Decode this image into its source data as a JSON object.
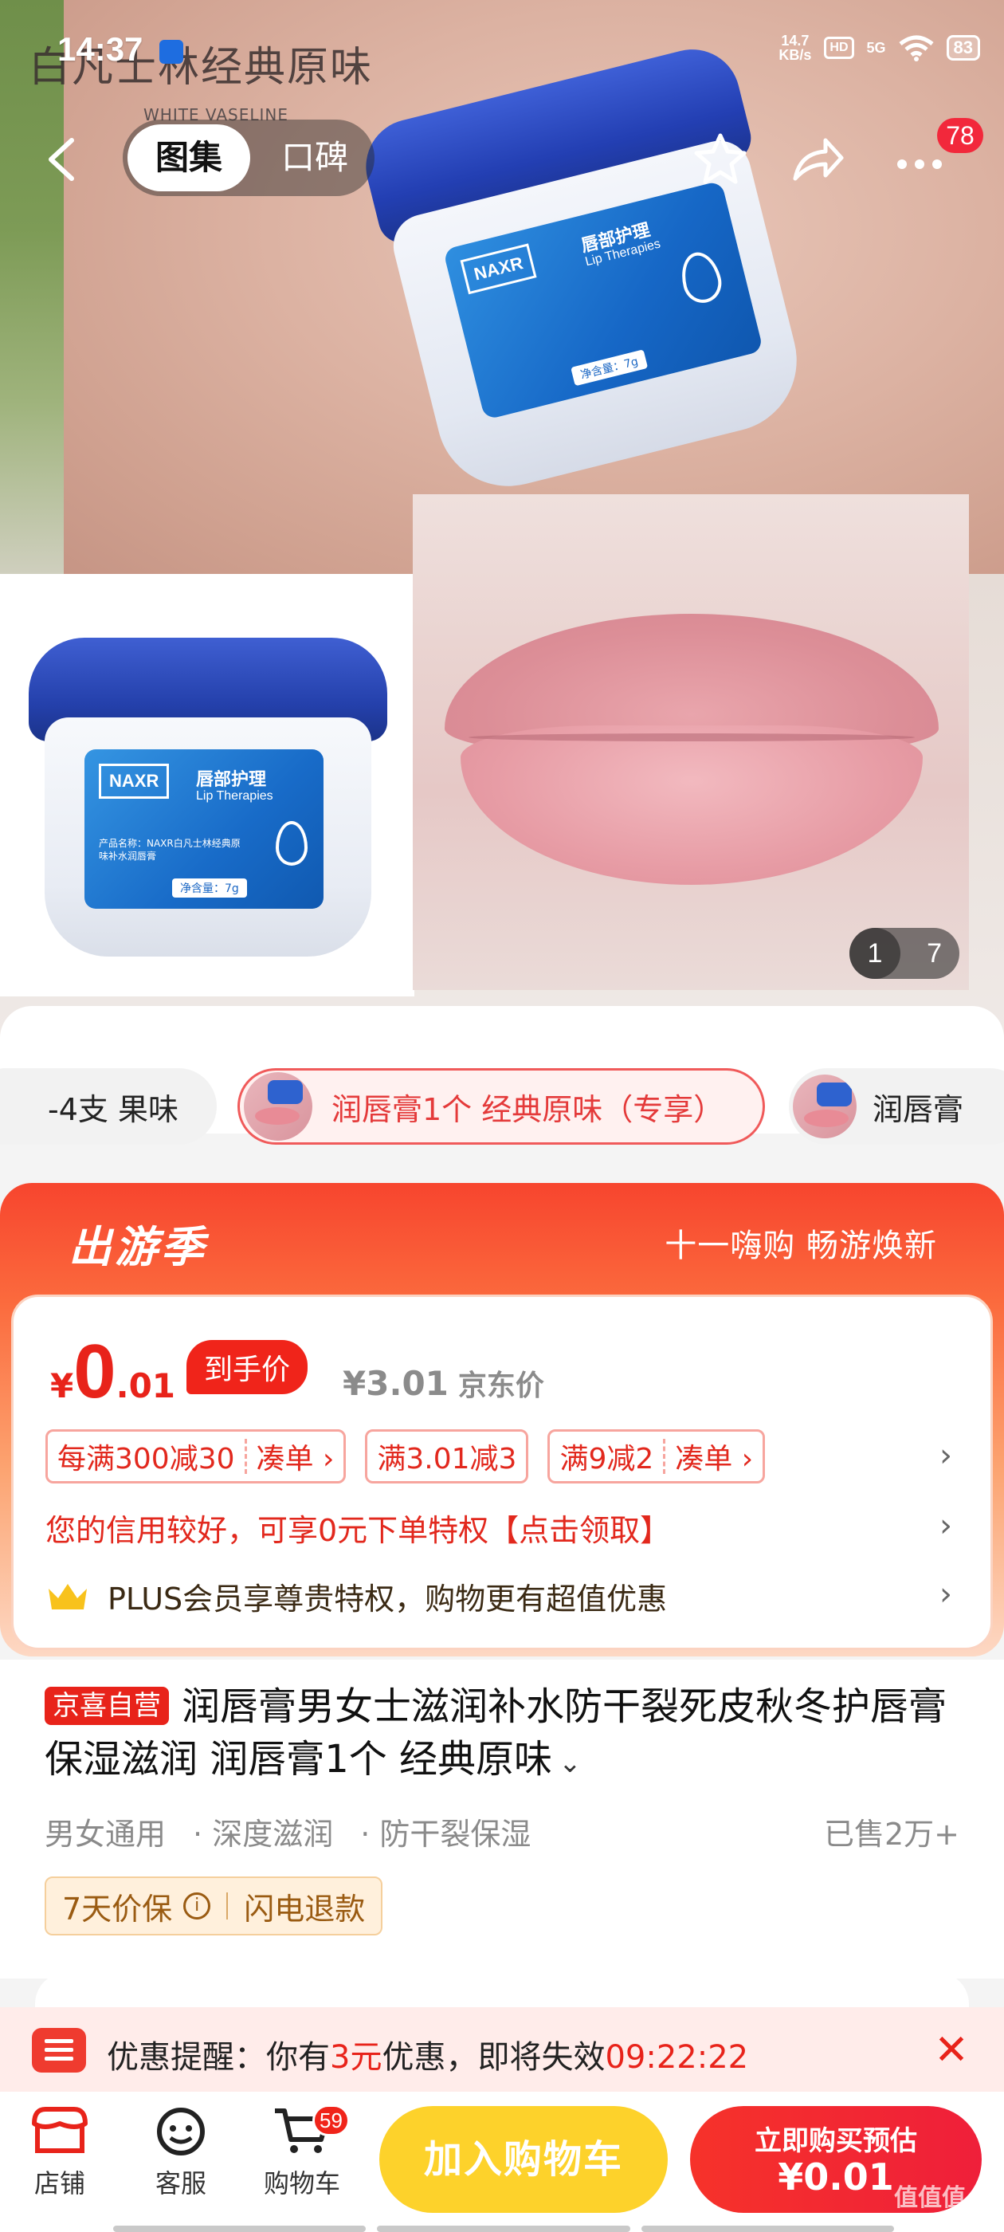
{
  "status_bar": {
    "time": "14:37",
    "net_speed_value": "14.7",
    "net_speed_unit": "KB/s",
    "hd": "HD",
    "network": "5G",
    "battery": "83"
  },
  "hero": {
    "ghost_title": "白凡士林经典原味",
    "ghost_subtitle": "WHITE VASELINE",
    "jar_brand": "NAXR",
    "jar_name_cn": "唇部护理",
    "jar_name_en": "Lip Therapies",
    "jar_info": "产品名称：NAXR白凡士林经典原味补水润唇膏",
    "jar_net": "净含量：7g",
    "counter_current": "1",
    "counter_total": "7"
  },
  "nav": {
    "tab_gallery": "图集",
    "tab_reviews": "口碑",
    "more_badge": "78"
  },
  "variants": {
    "items": [
      {
        "label": "-4支 果味"
      },
      {
        "label": "润唇膏1个 经典原味（专享）"
      },
      {
        "label": "润唇膏"
      }
    ]
  },
  "promo": {
    "title": "出游季",
    "slogan": "十一嗨购 畅游焕新",
    "price_symbol": "¥",
    "price_int": "0",
    "price_dec": ".01",
    "hand_price_label": "到手价",
    "jd_price": "¥3.01",
    "jd_price_label": "京东价",
    "coupons": [
      {
        "main": "每满300减30",
        "action": "凑单 ›"
      },
      {
        "main": "满3.01减3",
        "action": ""
      },
      {
        "main": "满9减2",
        "action": "凑单 ›"
      }
    ],
    "credit_text": "您的信用较好，可享0元下单特权【点击领取】",
    "plus_text": "PLUS会员享尊贵特权，购物更有超值优惠"
  },
  "product": {
    "tag": "京喜自营",
    "title": "润唇膏男女士滋润补水防干裂死皮秋冬护唇膏保湿滋润 润唇膏1个 经典原味",
    "features": [
      "男女通用",
      "深度滋润",
      "防干裂保湿"
    ],
    "sold": "已售2万+",
    "guarantee_a": "7天价保",
    "guarantee_b": "闪电退款"
  },
  "reminder": {
    "prefix": "优惠提醒：你有",
    "amount": "3元",
    "suffix": "优惠，即将失效",
    "countdown": "09:22:22"
  },
  "bottom_bar": {
    "shop": "店铺",
    "service": "客服",
    "cart": "购物车",
    "cart_badge": "59",
    "add_to_cart": "加入购物车",
    "buy_now_line1": "立即购买预估",
    "buy_now_line2": "¥0.01",
    "watermark": "值值值"
  },
  "colors": {
    "accent_red": "#e8231a",
    "cart_yellow": "#fdd22b",
    "jar_blue": "#2440ab"
  }
}
